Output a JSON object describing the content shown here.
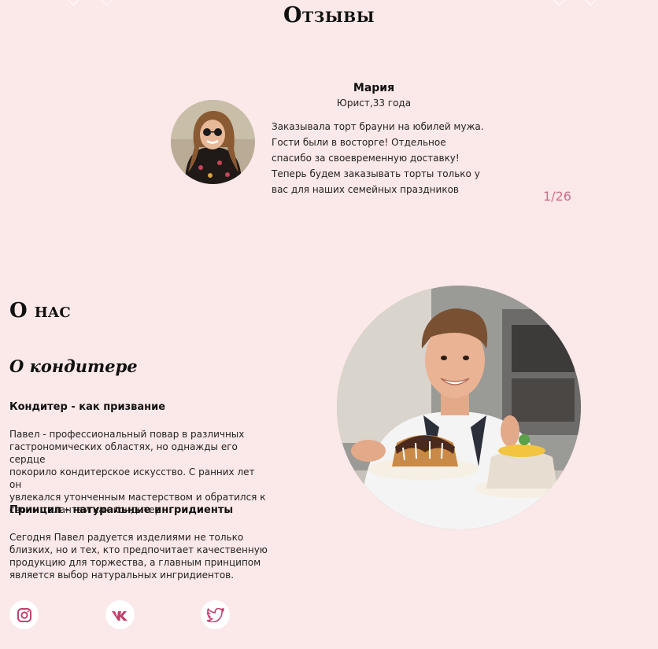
{
  "reviews": {
    "title": "Отзывы",
    "name": "Мария",
    "meta": "Юрист,33 года",
    "text_lines": [
      "Заказывала торт брауни на юбилей мужа.",
      "Гости были в восторге! Отдельное",
      "спасибо за своевременную доставку!",
      "Теперь будем заказывать торты только у",
      "вас для наших семейных праздников"
    ],
    "counter": "1/26"
  },
  "about": {
    "heading": "О нас",
    "subheading": "О кондитере",
    "sections": [
      {
        "title": "Кондитер - как призвание",
        "lines": [
          "Павел - профессиональный повар в различных",
          "гастрономических областях, но однажды его сердце",
          "покорило кондитерское искусство. С ранних лет он",
          "увлекался утонченным мастерством и обратился к",
          "своим талантам как кондитер"
        ]
      },
      {
        "title": "Принцип - натуральные ингридиенты",
        "lines": [
          "Сегодня Павел радуется изделиями не только",
          "близких, но и тех, кто предпочитает качественную",
          "продукцию для торжества, а главным принципом",
          "является выбор натуральных ингридиентов."
        ]
      }
    ]
  },
  "social": [
    {
      "icon": "instagram-icon"
    },
    {
      "icon": "vk-icon"
    },
    {
      "icon": "twitter-icon"
    }
  ],
  "colors": {
    "background": "#fbe8e8",
    "accent": "#d36d8a",
    "social_icon": "#c2416b"
  }
}
